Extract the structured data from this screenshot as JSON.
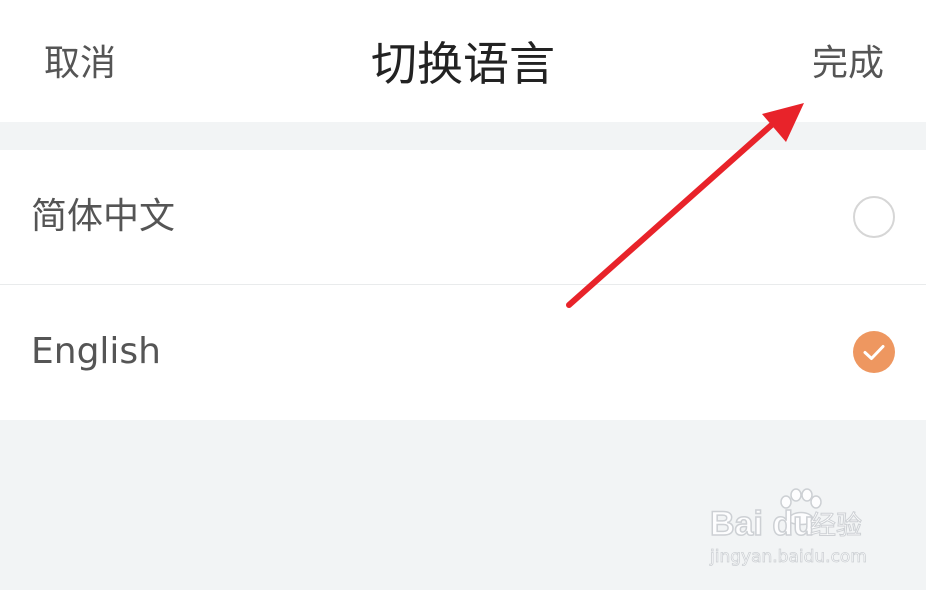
{
  "header": {
    "cancel_label": "取消",
    "title": "切换语言",
    "done_label": "完成"
  },
  "languages": [
    {
      "label": "简体中文",
      "selected": false
    },
    {
      "label": "English",
      "selected": true
    }
  ],
  "colors": {
    "accent": "#ee9760",
    "annotation_arrow": "#e8232a",
    "background": "#f2f4f5",
    "text": "#555555",
    "title": "#222222"
  },
  "icons": {
    "unselected": "radio-unchecked-icon",
    "selected": "radio-checked-icon",
    "annotation": "red-arrow-icon"
  },
  "watermark": {
    "brand": "Bai du",
    "sub": "经验",
    "url": "jingyan.baidu.com"
  }
}
